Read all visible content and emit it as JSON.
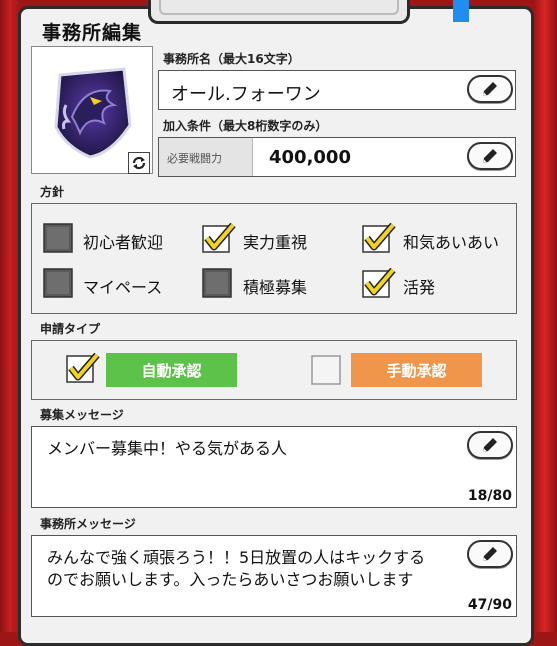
{
  "page": {
    "title": "事務所編集"
  },
  "office_name": {
    "label": "事務所名（最大16文字）",
    "value": "オール.フォーワン"
  },
  "join_condition": {
    "label": "加入条件（最大8桁数字のみ）",
    "field_label": "必要戦闘力",
    "value": "400,000"
  },
  "policy": {
    "label": "方針",
    "options": [
      {
        "label": "初心者歓迎",
        "checked": false
      },
      {
        "label": "実力重視",
        "checked": true
      },
      {
        "label": "和気あいあい",
        "checked": true
      },
      {
        "label": "マイペース",
        "checked": false
      },
      {
        "label": "積極募集",
        "checked": false
      },
      {
        "label": "活発",
        "checked": true
      }
    ]
  },
  "application_type": {
    "label": "申請タイプ",
    "auto": {
      "label": "自動承認",
      "checked": true,
      "color": "#5cc24a"
    },
    "manual": {
      "label": "手動承認",
      "checked": false,
      "color": "#f0964a"
    }
  },
  "recruit_message": {
    "label": "募集メッセージ",
    "text": "メンバー募集中！やる気がある人",
    "counter": "18/80"
  },
  "office_message": {
    "label": "事務所メッセージ",
    "line1": "みんなで強く頑張ろう！！5日放置の人はキックする",
    "line2": "のでお願いします。入ったらあいさつお願いします",
    "counter": "47/90"
  },
  "colors": {
    "frame_red": "#c92020",
    "panel_bg": "#f1f1f1",
    "check_yellow": "#f2d51a"
  },
  "icons": [
    "emblem-icon",
    "refresh-icon",
    "pencil-icon",
    "checkbox-icon",
    "checkmark-icon"
  ]
}
